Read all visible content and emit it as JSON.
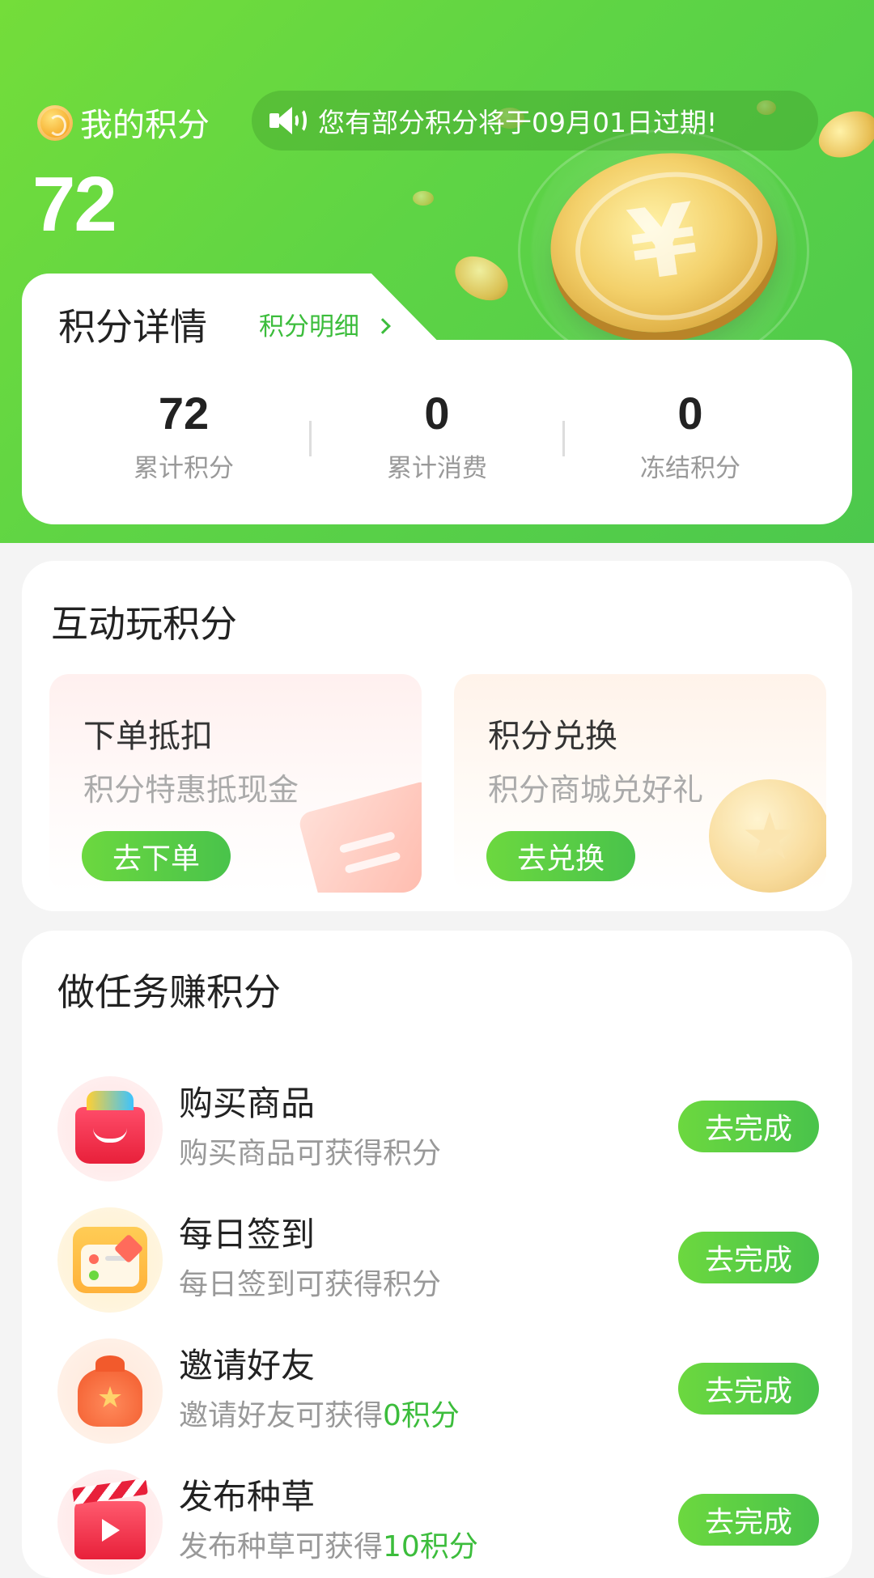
{
  "header": {
    "my_points_label": "我的积分",
    "notice": "您有部分积分将于09月01日过期!",
    "points_value": "72"
  },
  "details": {
    "title": "积分详情",
    "link": "积分明细",
    "stats": [
      {
        "value": "72",
        "label": "累计积分"
      },
      {
        "value": "0",
        "label": "累计消费"
      },
      {
        "value": "0",
        "label": "冻结积分"
      }
    ]
  },
  "interactive": {
    "title": "互动玩积分",
    "cards": [
      {
        "title": "下单抵扣",
        "subtitle": "积分特惠抵现金",
        "button": "去下单"
      },
      {
        "title": "积分兑换",
        "subtitle": "积分商城兑好礼",
        "button": "去兑换"
      }
    ]
  },
  "tasks": {
    "title": "做任务赚积分",
    "items": [
      {
        "title": "购买商品",
        "desc": "购买商品可获得积分",
        "desc_highlight": "",
        "button": "去完成",
        "icon": "shopping-bag-icon"
      },
      {
        "title": "每日签到",
        "desc": "每日签到可获得积分",
        "desc_highlight": "",
        "button": "去完成",
        "icon": "calendar-icon"
      },
      {
        "title": "邀请好友",
        "desc": "邀请好友可获得",
        "desc_highlight": "0积分",
        "button": "去完成",
        "icon": "gift-bag-icon"
      },
      {
        "title": "发布种草",
        "desc": "发布种草可获得",
        "desc_highlight": "10积分",
        "button": "去完成",
        "icon": "video-clapper-icon"
      }
    ]
  },
  "colors": {
    "accent_green": "#4cc84d",
    "header_gradient_start": "#74dd3a",
    "text_gray": "#999999"
  }
}
